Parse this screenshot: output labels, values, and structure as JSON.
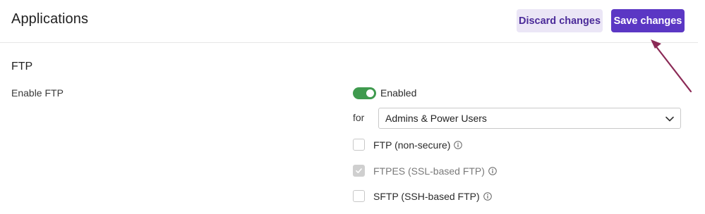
{
  "header": {
    "title": "Applications",
    "discard_label": "Discard changes",
    "save_label": "Save changes"
  },
  "section": {
    "title": "FTP",
    "enable_label": "Enable FTP",
    "toggle": {
      "state": "on",
      "label": "Enabled"
    },
    "for_label": "for",
    "for_select": {
      "value": "Admins & Power Users"
    },
    "protocols": [
      {
        "label": "FTP (non-secure)",
        "checked": false,
        "disabled": false
      },
      {
        "label": "FTPES (SSL-based FTP)",
        "checked": true,
        "disabled": true
      },
      {
        "label": "SFTP (SSH-based FTP)",
        "checked": false,
        "disabled": false
      }
    ]
  },
  "colors": {
    "accent": "#5b37c4",
    "accent_soft": "#ebe6f6",
    "toggle_on": "#3f9a4e",
    "annotation_arrow": "#8b2a56"
  }
}
